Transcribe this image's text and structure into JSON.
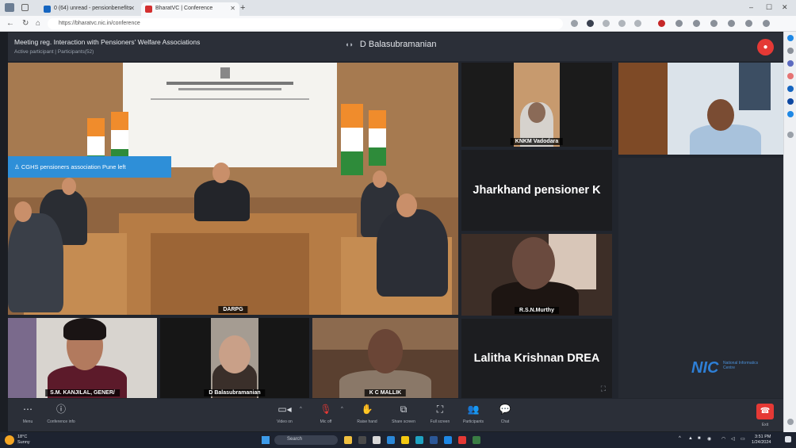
{
  "browser": {
    "tabs": [
      {
        "label": "0 (64) unread - pensionbenefits",
        "active": false
      },
      {
        "label": "BharatVC | Conference",
        "active": true
      }
    ],
    "new_tab": "+",
    "url": "https://bharatvc.nic.in/conference",
    "win_min": "–",
    "win_max": "☐",
    "win_close": "✕"
  },
  "meeting": {
    "title": "Meeting reg. Interaction with Pensioners' Welfare Associations",
    "subtitle": "Active participant | Participants(52)",
    "active_speaker": "D Balasubramanian",
    "notification": "CGHS pensioners association Pune left"
  },
  "tiles": {
    "main": {
      "name": "DARPG"
    },
    "t1": {
      "name": "KNKM Vadodara"
    },
    "t2": {
      "name": "Jharkhand pensioner K"
    },
    "t3": {
      "name": "R.S.N.Murthy"
    },
    "t4": {
      "name": "Lalitha Krishnan DREA"
    },
    "b1": {
      "name": "S.M. KANJILAL, GENER/"
    },
    "b2": {
      "name": "D Balasubramanian"
    },
    "b3": {
      "name": "K C MALLIK"
    },
    "nic_logo": "NIC",
    "nic_text": "National Informatics Centre"
  },
  "toolbar": {
    "menu": "Menu",
    "conference_info": "Conference info",
    "video": "Video on",
    "mic": "Mic off",
    "raise_hand": "Raise hand",
    "share": "Share screen",
    "fullscreen": "Full screen",
    "participants": "Participants",
    "chat": "Chat",
    "leave": "Exit"
  },
  "taskbar": {
    "weather_temp": "18°C",
    "weather_desc": "Sunny",
    "search": "Search",
    "time": "3:51 PM",
    "date": "1/24/2024"
  }
}
